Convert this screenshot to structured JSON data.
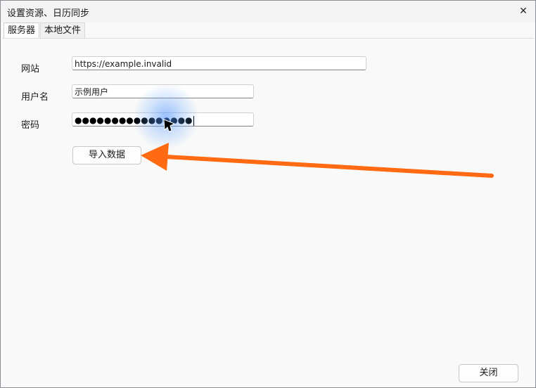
{
  "window": {
    "title": "设置资源、日历同步",
    "close_glyph": "✕"
  },
  "tabs": [
    {
      "label": "服务器",
      "active": true
    },
    {
      "label": "本地文件",
      "active": false
    }
  ],
  "form": {
    "website_label": "网站",
    "website_value": "https://example.invalid",
    "username_label": "用户名",
    "username_value": "示例用户",
    "password_label": "密码",
    "password_masked": "●●●●●●●●●●●●●●●●"
  },
  "buttons": {
    "import_label": "导入数据",
    "close_label": "关闭"
  },
  "annotation": {
    "arrow_color": "#ff6a13",
    "highlight_color": "#4f8ff7"
  }
}
